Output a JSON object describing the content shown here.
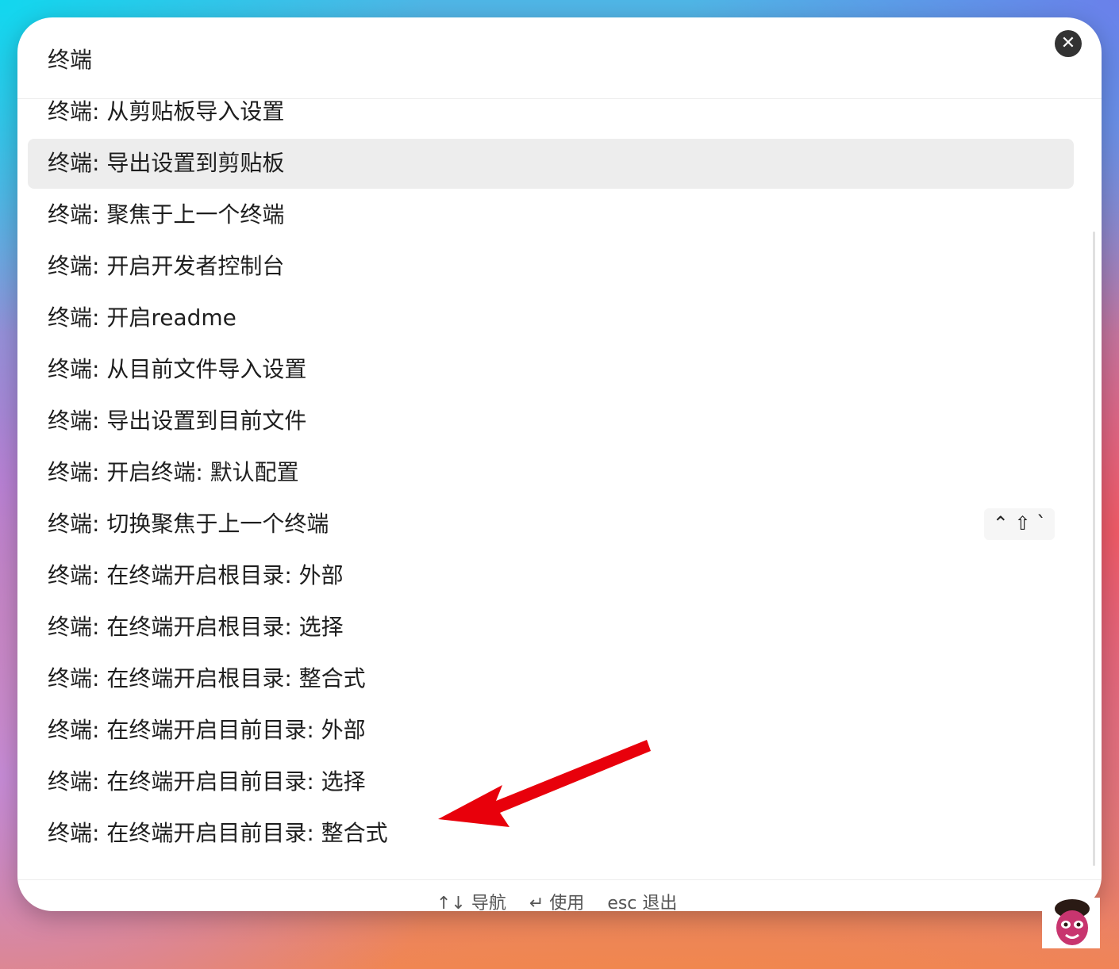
{
  "search": {
    "value": "终端"
  },
  "results": [
    {
      "label": "终端: 从剪贴板导入设置"
    },
    {
      "label": "终端: 导出设置到剪贴板"
    },
    {
      "label": "终端: 聚焦于上一个终端"
    },
    {
      "label": "终端: 开启开发者控制台"
    },
    {
      "label": "终端: 开启readme"
    },
    {
      "label": "终端: 从目前文件导入设置"
    },
    {
      "label": "终端: 导出设置到目前文件"
    },
    {
      "label": "终端: 开启终端: 默认配置"
    },
    {
      "label": "终端: 切换聚焦于上一个终端",
      "shortcut": "⌃ ⇧ `"
    },
    {
      "label": "终端: 在终端开启根目录: 外部"
    },
    {
      "label": "终端: 在终端开启根目录: 选择"
    },
    {
      "label": "终端: 在终端开启根目录: 整合式"
    },
    {
      "label": "终端: 在终端开启目前目录: 外部"
    },
    {
      "label": "终端: 在终端开启目前目录: 选择"
    },
    {
      "label": "终端: 在终端开启目前目录: 整合式"
    }
  ],
  "active_index": 1,
  "footer": {
    "navigate": "↑↓ 导航",
    "use": "↵ 使用",
    "exit": "esc 退出"
  },
  "colors": {
    "highlight": "#ededed",
    "arrow": "#e8000b"
  }
}
